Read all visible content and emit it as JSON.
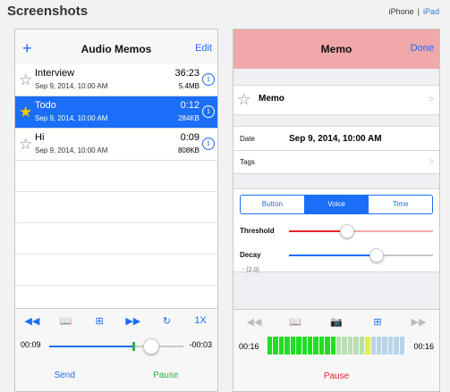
{
  "page": {
    "title": "Screenshots",
    "device_iphone": "iPhone",
    "device_sep": "|",
    "device_ipad": "iPad"
  },
  "left": {
    "nav": {
      "add_label": "+",
      "title": "Audio Memos",
      "edit_label": "Edit"
    },
    "memos": [
      {
        "title": "Interview",
        "date": "Sep 9, 2014, 10:00 AM",
        "duration": "36:23",
        "size": "5.4MB",
        "selected": false
      },
      {
        "title": "Todo",
        "date": "Sep 9, 2014, 10:00 AM",
        "duration": "0:12",
        "size": "284KB",
        "selected": true
      },
      {
        "title": "Hi",
        "date": "Sep 9, 2014, 10:00 AM",
        "duration": "0:09",
        "size": "808KB",
        "selected": false
      }
    ],
    "toolbar": {
      "rewind": "◀◀",
      "bookmarks": "📖",
      "add_bookmark": "⊞",
      "forward": "▶▶",
      "loop": "↻",
      "speed": "1X"
    },
    "player": {
      "elapsed": "00:09",
      "remaining": "-00:03",
      "progress": 0.75,
      "marker": 0.62
    },
    "bottom": {
      "send": "Send",
      "pause": "Pause"
    }
  },
  "right": {
    "nav": {
      "title": "Memo",
      "done_label": "Done"
    },
    "memo_title": "Memo",
    "date_label": "Date",
    "date_value": "Sep 9, 2014, 10:00 AM",
    "tags_label": "Tags",
    "segments": [
      {
        "label": "Button",
        "active": false
      },
      {
        "label": "Voice",
        "active": true
      },
      {
        "label": "Time",
        "active": false
      }
    ],
    "threshold_label": "Threshold",
    "threshold_value": 0.4,
    "decay_label": "Decay",
    "decay_value": 0.6,
    "default_note": "- (2.0)",
    "toolbar": {
      "rewind": "◀◀",
      "bookmarks": "📖",
      "camera": "📷",
      "add_bookmark": "⊞",
      "forward": "▶▶"
    },
    "player": {
      "elapsed": "00:16",
      "remaining": "00:16"
    },
    "meter_levels": [
      "#22dd22",
      "#22dd22",
      "#22dd22",
      "#22dd22",
      "#22dd22",
      "#22dd22",
      "#22dd22",
      "#22dd22",
      "#22dd22",
      "#22dd22",
      "#22dd22",
      "#22dd22",
      "#b8dfb0",
      "#b8dfb0",
      "#b8dfb0",
      "#b8dfb0",
      "#b8dfb0",
      "#e3f04a",
      "#b8d4e8",
      "#b8d4e8",
      "#b8d4e8",
      "#b8d4e8",
      "#b8d4e8",
      "#b8d4e8"
    ],
    "bottom": {
      "pause": "Pause"
    }
  },
  "colors": {
    "accent": "#1a6ef7",
    "pause_green": "#2bb24c",
    "pause_red": "#e8232a",
    "memo_nav": "#f0a8aa"
  }
}
